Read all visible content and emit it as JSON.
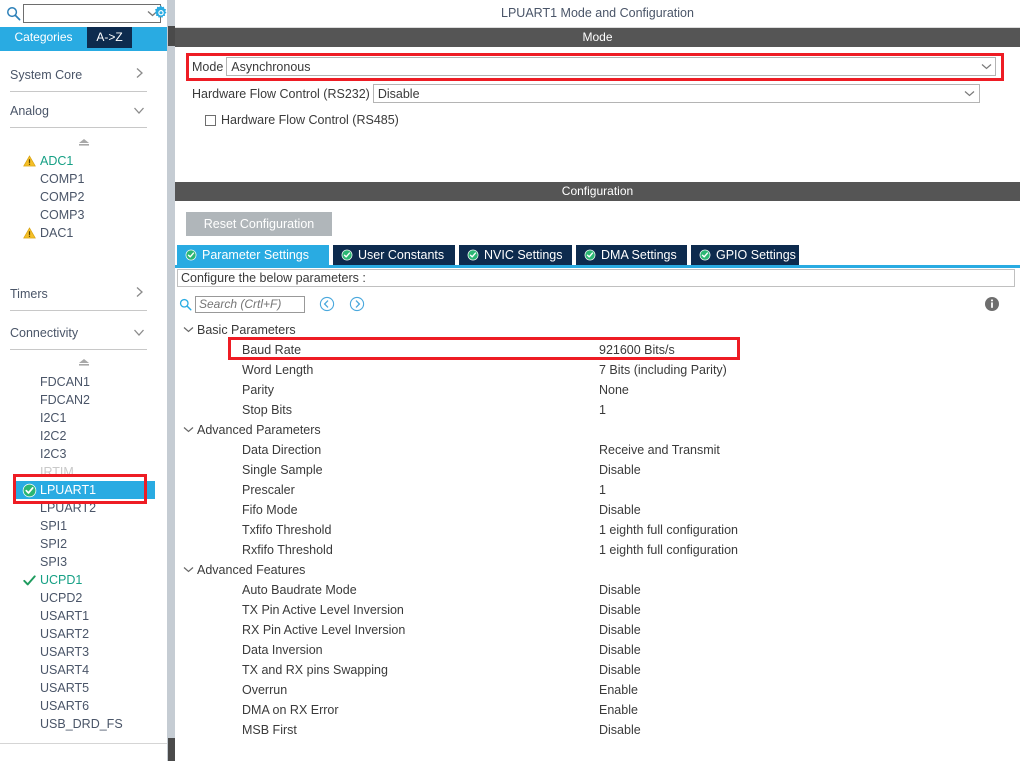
{
  "left_panel": {
    "search": {
      "value": "",
      "placeholder": "",
      "icon": "search-icon",
      "dropdown_arrow": "chevron-down-icon"
    },
    "settings_gear": "gear-icon",
    "tabs": [
      {
        "label": "Categories",
        "active": true
      },
      {
        "label": "A->Z",
        "active": false
      }
    ],
    "groups": [
      {
        "label": "System Core",
        "chevron": "›",
        "expanded": false
      },
      {
        "label": "Analog",
        "chevron": "∨",
        "expanded": true
      },
      {
        "label": "Timers",
        "chevron": "›",
        "expanded": false
      },
      {
        "label": "Connectivity",
        "chevron": "∨",
        "expanded": true
      }
    ],
    "analog_items": [
      {
        "label": "ADC1",
        "badge": "warning",
        "state": "configured"
      },
      {
        "label": "COMP1",
        "badge": "none",
        "state": "normal"
      },
      {
        "label": "COMP2",
        "badge": "none",
        "state": "normal"
      },
      {
        "label": "COMP3",
        "badge": "none",
        "state": "normal"
      },
      {
        "label": "DAC1",
        "badge": "warning",
        "state": "normal"
      }
    ],
    "connectivity_items": [
      {
        "label": "FDCAN1",
        "badge": "none",
        "state": "normal"
      },
      {
        "label": "FDCAN2",
        "badge": "none",
        "state": "normal"
      },
      {
        "label": "I2C1",
        "badge": "none",
        "state": "normal"
      },
      {
        "label": "I2C2",
        "badge": "none",
        "state": "normal"
      },
      {
        "label": "I2C3",
        "badge": "none",
        "state": "normal"
      },
      {
        "label": "IRTIM",
        "badge": "none",
        "state": "disabled"
      },
      {
        "label": "LPUART1",
        "badge": "check-circle",
        "state": "selected"
      },
      {
        "label": "LPUART2",
        "badge": "none",
        "state": "normal"
      },
      {
        "label": "SPI1",
        "badge": "none",
        "state": "normal"
      },
      {
        "label": "SPI2",
        "badge": "none",
        "state": "normal"
      },
      {
        "label": "SPI3",
        "badge": "none",
        "state": "normal"
      },
      {
        "label": "UCPD1",
        "badge": "check",
        "state": "configured"
      },
      {
        "label": "UCPD2",
        "badge": "none",
        "state": "normal"
      },
      {
        "label": "USART1",
        "badge": "none",
        "state": "normal"
      },
      {
        "label": "USART2",
        "badge": "none",
        "state": "normal"
      },
      {
        "label": "USART3",
        "badge": "none",
        "state": "normal"
      },
      {
        "label": "USART4",
        "badge": "none",
        "state": "normal"
      },
      {
        "label": "USART5",
        "badge": "none",
        "state": "normal"
      },
      {
        "label": "USART6",
        "badge": "none",
        "state": "normal"
      },
      {
        "label": "USB_DRD_FS",
        "badge": "none",
        "state": "normal"
      }
    ]
  },
  "right_panel": {
    "title": "LPUART1 Mode and Configuration",
    "mode_section": {
      "header": "Mode",
      "mode_label": "Mode",
      "mode_value": "Asynchronous",
      "flow_label": "Hardware Flow Control (RS232)",
      "flow_value": "Disable",
      "rs485_label": "Hardware Flow Control (RS485)",
      "rs485_checked": false
    },
    "config_section": {
      "header": "Configuration",
      "reset_button": "Reset Configuration",
      "tabs": [
        {
          "label": "Parameter Settings",
          "active": true
        },
        {
          "label": "User Constants",
          "active": false
        },
        {
          "label": "NVIC Settings",
          "active": false
        },
        {
          "label": "DMA Settings",
          "active": false
        },
        {
          "label": "GPIO Settings",
          "active": false
        }
      ],
      "configure_hint": "Configure the below parameters :",
      "search_placeholder": "Search (Crtl+F)",
      "search_value": "",
      "nav_prev": "prev-icon",
      "nav_next": "next-icon",
      "info_icon": "info-icon"
    },
    "parameters": [
      {
        "group": "Basic Parameters",
        "rows": [
          {
            "name": "Baud Rate",
            "value": "921600 Bits/s",
            "highlighted": true
          },
          {
            "name": "Word Length",
            "value": "7 Bits (including Parity)",
            "highlighted": false
          },
          {
            "name": "Parity",
            "value": "None",
            "highlighted": false
          },
          {
            "name": "Stop Bits",
            "value": "1",
            "highlighted": false
          }
        ]
      },
      {
        "group": "Advanced Parameters",
        "rows": [
          {
            "name": "Data Direction",
            "value": "Receive and Transmit",
            "highlighted": false
          },
          {
            "name": "Single Sample",
            "value": "Disable",
            "highlighted": false
          },
          {
            "name": "Prescaler",
            "value": "1",
            "highlighted": false
          },
          {
            "name": "Fifo Mode",
            "value": "Disable",
            "highlighted": false
          },
          {
            "name": "Txfifo Threshold",
            "value": "1 eighth full configuration",
            "highlighted": false
          },
          {
            "name": "Rxfifo Threshold",
            "value": "1 eighth full configuration",
            "highlighted": false
          }
        ]
      },
      {
        "group": "Advanced Features",
        "rows": [
          {
            "name": "Auto Baudrate Mode",
            "value": "Disable",
            "highlighted": false
          },
          {
            "name": "TX Pin Active Level Inversion",
            "value": "Disable",
            "highlighted": false
          },
          {
            "name": "RX Pin Active Level Inversion",
            "value": "Disable",
            "highlighted": false
          },
          {
            "name": "Data Inversion",
            "value": "Disable",
            "highlighted": false
          },
          {
            "name": "TX and RX pins Swapping",
            "value": "Disable",
            "highlighted": false
          },
          {
            "name": "Overrun",
            "value": "Enable",
            "highlighted": false
          },
          {
            "name": "DMA on RX Error",
            "value": "Enable",
            "highlighted": false
          },
          {
            "name": "MSB First",
            "value": "Disable",
            "highlighted": false
          }
        ]
      }
    ]
  },
  "annotations": {
    "highlight_color": "#ee1c24",
    "boxes": [
      "mode-row",
      "lpuart1-item",
      "baud-rate-row"
    ]
  },
  "colors": {
    "accent_blue": "#29abe2",
    "tab_navy": "#0d2b4e",
    "section_gray": "#555555",
    "green": "#16a085",
    "warning_yellow": "#f5bf26"
  }
}
